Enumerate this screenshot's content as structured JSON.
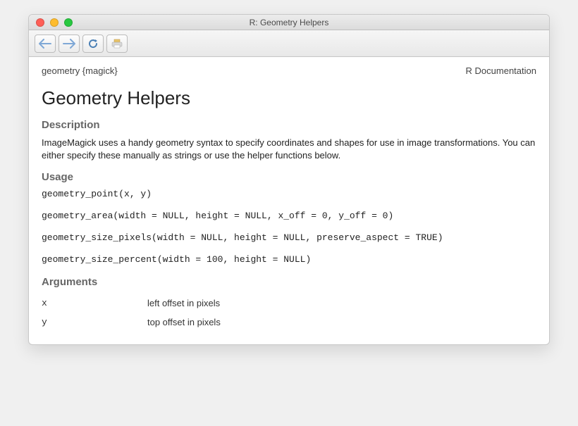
{
  "window": {
    "title": "R: Geometry Helpers"
  },
  "doc_header": {
    "left": "geometry {magick}",
    "right": "R Documentation"
  },
  "page_title": "Geometry Helpers",
  "sections": {
    "description_label": "Description",
    "description_text": "ImageMagick uses a handy geometry syntax to specify coordinates and shapes for use in image transformations. You can either specify these manually as strings or use the helper functions below.",
    "usage_label": "Usage",
    "usage_lines": [
      "geometry_point(x, y)",
      "geometry_area(width = NULL, height = NULL, x_off = 0, y_off = 0)",
      "geometry_size_pixels(width = NULL, height = NULL, preserve_aspect = TRUE)",
      "geometry_size_percent(width = 100, height = NULL)"
    ],
    "arguments_label": "Arguments",
    "arguments": [
      {
        "name": "x",
        "desc": "left offset in pixels"
      },
      {
        "name": "y",
        "desc": "top offset in pixels"
      }
    ]
  }
}
